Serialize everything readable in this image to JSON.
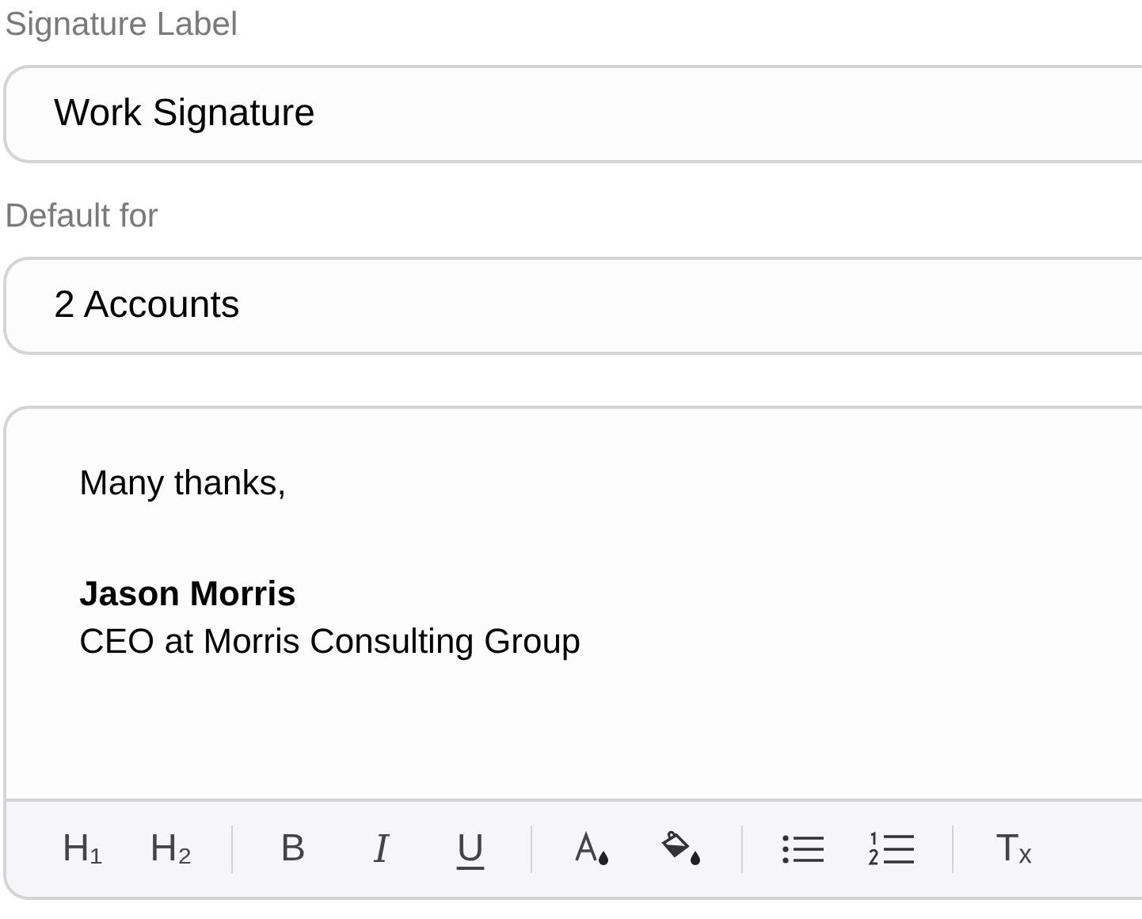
{
  "fields": [
    {
      "label": "Signature Label",
      "value": "Work Signature"
    },
    {
      "label": "Default for",
      "value": "2 Accounts"
    }
  ],
  "editor": {
    "paragraphs": [
      {
        "lines": [
          {
            "text": "Many thanks,",
            "bold": false
          }
        ]
      },
      {
        "lines": [
          {
            "text": "Jason Morris",
            "bold": true
          },
          {
            "text": "CEO at Morris Consulting Group",
            "bold": false
          }
        ]
      }
    ],
    "toolbar": [
      [
        {
          "kind": "heading1",
          "label": "H₁"
        },
        {
          "kind": "heading2",
          "label": "H₂"
        }
      ],
      [
        {
          "kind": "bold",
          "label": "B"
        },
        {
          "kind": "italic",
          "label": "I"
        },
        {
          "kind": "underline",
          "label": "U"
        }
      ],
      [
        {
          "kind": "text-color"
        },
        {
          "kind": "fill-color"
        }
      ],
      [
        {
          "kind": "bullet-list"
        },
        {
          "kind": "numbered-list"
        }
      ],
      [
        {
          "kind": "clear-format",
          "label": "Tₓ"
        }
      ]
    ]
  }
}
